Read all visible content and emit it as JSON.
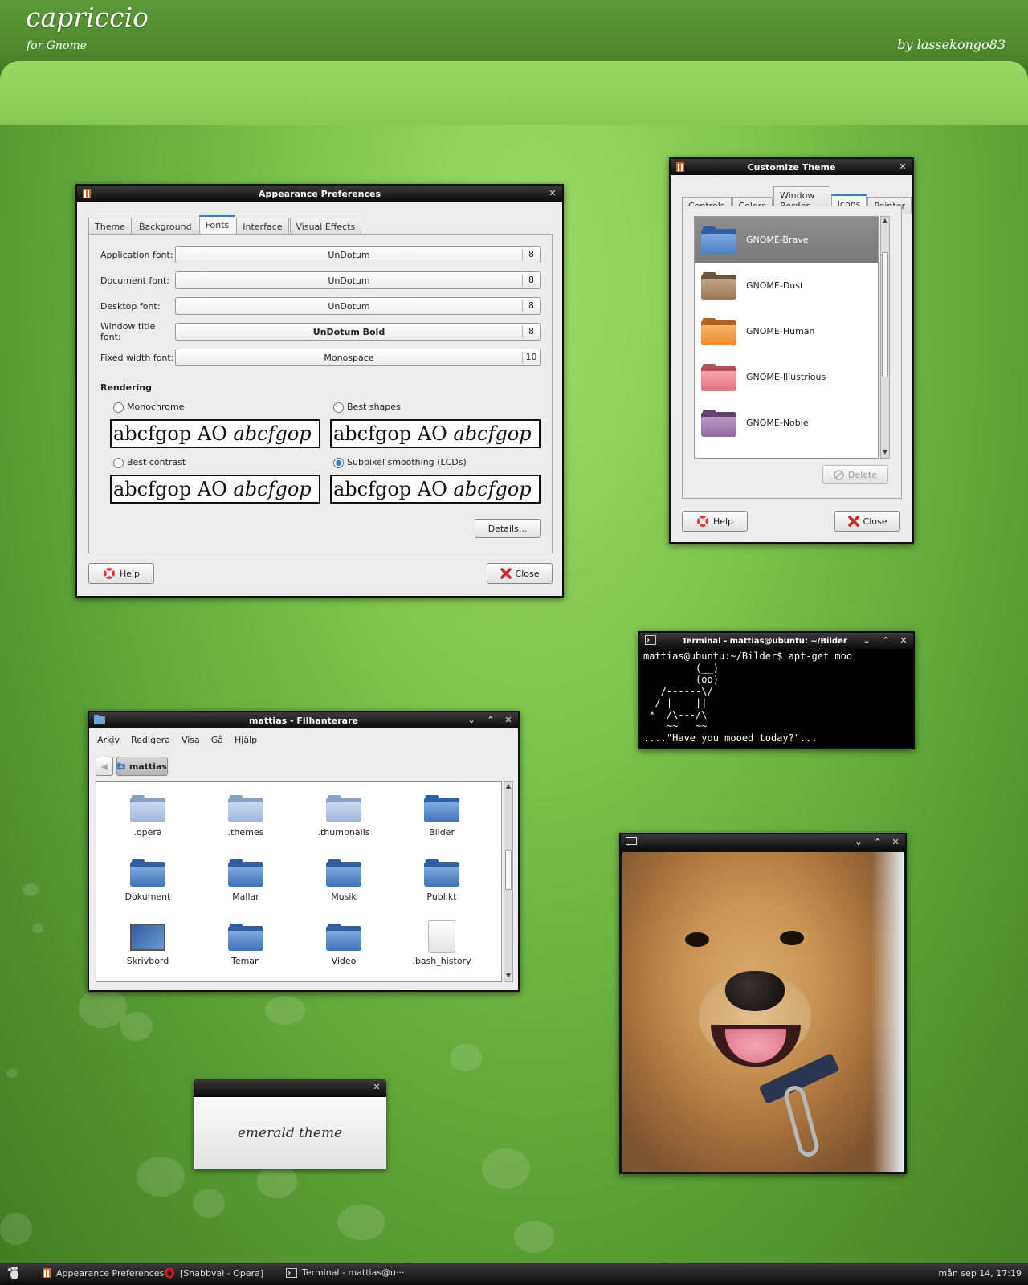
{
  "header": {
    "title": "capriccio",
    "subtitle": "for Gnome",
    "author": "by lassekongo83"
  },
  "appearance": {
    "title": "Appearance Preferences",
    "tabs": [
      "Theme",
      "Background",
      "Fonts",
      "Interface",
      "Visual Effects"
    ],
    "fonts": [
      {
        "label": "Application font:",
        "name": "UnDotum",
        "size": "8"
      },
      {
        "label": "Document font:",
        "name": "UnDotum",
        "size": "8"
      },
      {
        "label": "Desktop font:",
        "name": "UnDotum",
        "size": "8"
      },
      {
        "label": "Window title font:",
        "name": "UnDotum Bold",
        "size": "8"
      },
      {
        "label": "Fixed width font:",
        "name": "Monospace",
        "size": "10"
      }
    ],
    "rendering_heading": "Rendering",
    "options": [
      "Monochrome",
      "Best shapes",
      "Best contrast",
      "Subpixel smoothing (LCDs)"
    ],
    "selected_option": "Subpixel smoothing (LCDs)",
    "sample_plain": "abcfgop AO",
    "sample_italic": "abcfgop",
    "details_label": "Details...",
    "help_label": "Help",
    "close_label": "Close"
  },
  "customize": {
    "title": "Customize Theme",
    "tabs": [
      "Controls",
      "Colors",
      "Window Border",
      "Icons",
      "Pointer"
    ],
    "themes": [
      {
        "name": "GNOME-Brave",
        "color": "#4a7fc4"
      },
      {
        "name": "GNOME-Dust",
        "color": "#9a7556"
      },
      {
        "name": "GNOME-Human",
        "color": "#ef8a2a"
      },
      {
        "name": "GNOME-Illustrious",
        "color": "#e8707f"
      },
      {
        "name": "GNOME-Noble",
        "color": "#8e6a9e"
      }
    ],
    "delete_label": "Delete",
    "help_label": "Help",
    "close_label": "Close"
  },
  "terminal": {
    "title": "Terminal - mattias@ubuntu: ~/Bilder",
    "lines": [
      "mattias@ubuntu:~/Bilder$ apt-get moo",
      "         (__)",
      "         (oo)",
      "   /------\\/",
      "  / |    ||",
      " *  /\\---/\\",
      "    ~~   ~~",
      "....\"Have you mooed today?\"..."
    ]
  },
  "filemanager": {
    "title": "mattias - Filhanterare",
    "menu": [
      "Arkiv",
      "Redigera",
      "Visa",
      "Gå",
      "Hjälp"
    ],
    "location": "mattias",
    "items": [
      ".opera",
      ".themes",
      ".thumbnails",
      "Bilder",
      "Dokument",
      "Mallar",
      "Musik",
      "Publikt",
      "Skrivbord",
      "Teman",
      "Video",
      ".bash_history"
    ]
  },
  "emerald": {
    "label": "emerald theme"
  },
  "taskbar": {
    "tasks": [
      "Appearance Preferences",
      "[Snabbval - Opera]",
      "Terminal - mattias@u···"
    ],
    "clock": "mån sep 14, 17:19"
  }
}
